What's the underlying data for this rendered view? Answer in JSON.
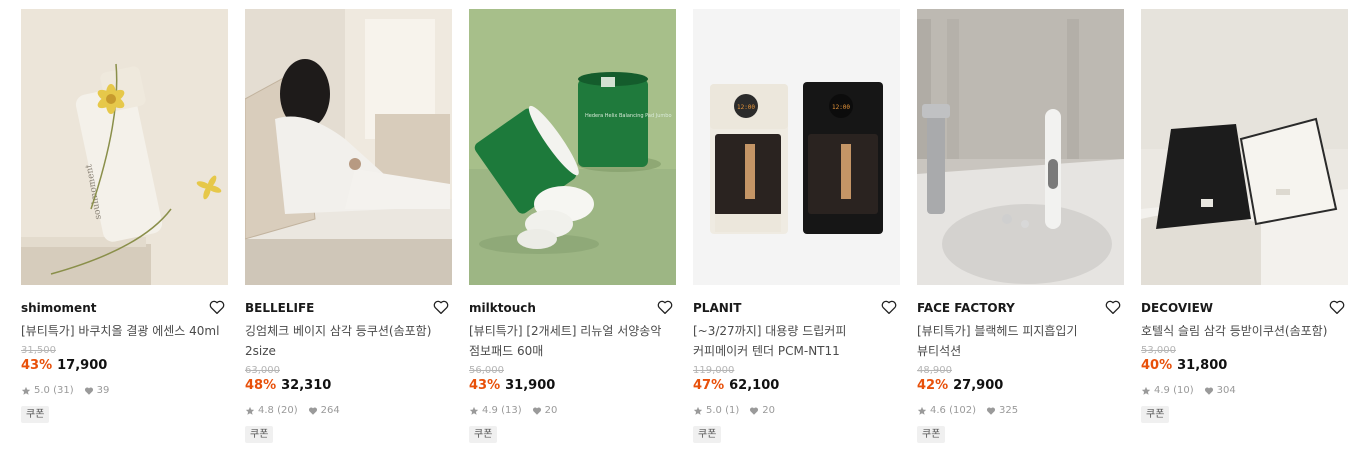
{
  "products": [
    {
      "brand": "shimoment",
      "title": "[뷰티특가] 바쿠치올 결광 에센스 40ml",
      "original_price": "31,500",
      "discount": "43%",
      "price": "17,900",
      "rating": "5.0",
      "reviews": "(31)",
      "likes": "39",
      "coupon": "쿠폰",
      "image_label": "soulmoment"
    },
    {
      "brand": "BELLELIFE",
      "title": "깅엄체크 베이지 삼각 등쿠션(솜포함) 2size",
      "original_price": "63,000",
      "discount": "48%",
      "price": "32,310",
      "rating": "4.8",
      "reviews": "(20)",
      "likes": "264",
      "coupon": "쿠폰"
    },
    {
      "brand": "milktouch",
      "title": "[뷰티특가] [2개세트] 리뉴얼 서양송악 점보패드 60매",
      "original_price": "56,000",
      "discount": "43%",
      "price": "31,900",
      "rating": "4.9",
      "reviews": "(13)",
      "likes": "20",
      "coupon": "쿠폰",
      "image_label": "Hedera Helix Balancing Pad Jumbo"
    },
    {
      "brand": "PLANIT",
      "title": "[~3/27까지] 대용량 드립커피 커피메이커 텐더 PCM-NT11",
      "original_price": "119,000",
      "discount": "47%",
      "price": "62,100",
      "rating": "5.0",
      "reviews": "(1)",
      "likes": "20",
      "coupon": "쿠폰",
      "image_label": "12:00"
    },
    {
      "brand": "FACE FACTORY",
      "title": "[뷰티특가] 블랙헤드 피지흡입기 뷰티석션",
      "original_price": "48,900",
      "discount": "42%",
      "price": "27,900",
      "rating": "4.6",
      "reviews": "(102)",
      "likes": "325",
      "coupon": "쿠폰"
    },
    {
      "brand": "DECOVIEW",
      "title": "호텔식 슬림 삼각 등받이쿠션(솜포함)",
      "original_price": "53,000",
      "discount": "40%",
      "price": "31,800",
      "rating": "4.9",
      "reviews": "(10)",
      "likes": "304",
      "coupon": "쿠폰"
    }
  ],
  "icons": {
    "heart": "heart-outline-icon",
    "star": "star-icon",
    "like": "heart-filled-icon"
  },
  "colors": {
    "discount": "#e8500a",
    "meta": "#9a9a9a",
    "coupon_bg": "#f0f0f0"
  }
}
